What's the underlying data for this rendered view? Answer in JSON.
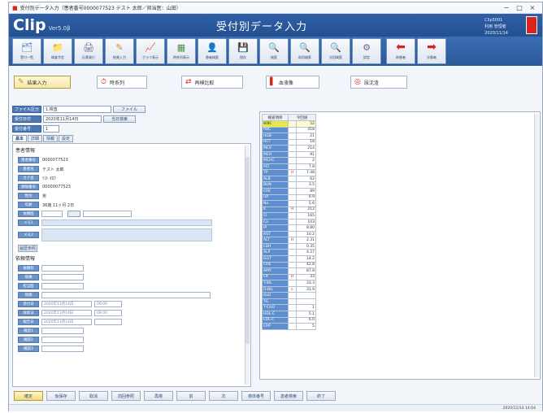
{
  "window": {
    "title": "受付別データ入力（患者番号0000077523 テスト 太郎／担当医：山田）",
    "controls": [
      "−",
      "□",
      "×"
    ]
  },
  "header": {
    "logo": "Clip",
    "version": "Ver5.0β",
    "screen_title": "受付別データ入力",
    "info_line1": "Clip5001",
    "info_line2": "利用 管理者",
    "info_line3": "2020/11/14"
  },
  "toolbar": {
    "items": [
      {
        "label": "受付一覧",
        "icon": "🗂",
        "color": "#3d7fc6"
      },
      {
        "label": "検査予定",
        "icon": "📁",
        "color": "#c9a13a"
      },
      {
        "label": "伝票発行",
        "icon": "🖨",
        "color": "#5c6e86"
      },
      {
        "label": "結果入力",
        "icon": "✎",
        "color": "#d88a26"
      },
      {
        "label": "グラフ表示",
        "icon": "📈",
        "color": "#cf3f3f"
      },
      {
        "label": "時系列表示",
        "icon": "▦",
        "color": "#4f8f4f"
      },
      {
        "label": "患者検索",
        "icon": "👤",
        "color": "#3f6fae"
      },
      {
        "label": "保存",
        "icon": "💾",
        "color": "#2f4f7f"
      },
      {
        "label": "検索",
        "icon": "🔍",
        "color": "#3f6fae"
      },
      {
        "label": "前回検索",
        "icon": "🔍",
        "color": "#3f6fae"
      },
      {
        "label": "次回検索",
        "icon": "🔍",
        "color": "#3f6fae"
      },
      {
        "label": "設定",
        "icon": "⚙",
        "color": "#5a6f8a"
      },
      {
        "label": "前患者",
        "icon": "⬅",
        "color": "#d8241f"
      },
      {
        "label": "次患者",
        "icon": "➡",
        "color": "#d8241f"
      }
    ]
  },
  "modes": {
    "items": [
      {
        "label": "結果入力",
        "icon": "✎",
        "active": true
      },
      {
        "label": "時系列",
        "icon": "⏱",
        "active": false
      },
      {
        "label": "再検比較",
        "icon": "⇄",
        "active": false
      },
      {
        "label": "血液像",
        "icon": "▌",
        "active": false
      },
      {
        "label": "尿沈渣",
        "icon": "◎",
        "active": false
      }
    ]
  },
  "form": {
    "type_label": "ファイル区分",
    "type_value": "1.検査",
    "sel_button": "ファイル",
    "date_label": "受付日付",
    "date_value": "2020年11月14日",
    "date_button": "当日検索",
    "number_label": "受付番号",
    "number_value": "1"
  },
  "tabs": [
    "基本",
    "詳細",
    "情報",
    "設定"
  ],
  "patient": {
    "section_title": "患者情報",
    "rows": [
      {
        "label": "患者番号",
        "value": "0000077523"
      },
      {
        "label": "患者名",
        "value": "テスト 太郎"
      },
      {
        "label": "カナ名",
        "value": "ﾃｽﾄ ﾀﾛｳ"
      },
      {
        "label": "保険番号",
        "value": "00000077523"
      },
      {
        "label": "性別",
        "value": "男"
      },
      {
        "label": "年齢",
        "value": "36歳 11ヶ月 2日"
      }
    ],
    "button_row_label": "依頼医",
    "memo_label1": "メモ1",
    "memo_label2": "メモ2",
    "history_button": "履歴参照"
  },
  "request": {
    "section_title": "依頼情報",
    "rows": [
      {
        "label": "依頼科",
        "value": ""
      },
      {
        "label": "病棟",
        "value": ""
      },
      {
        "label": "担当医",
        "value": ""
      },
      {
        "label": "保険",
        "value": ""
      },
      {
        "label": "受付日",
        "value": "2020年11月14日",
        "time": "09:00"
      },
      {
        "label": "採取日",
        "value": "2020年11月14日",
        "time": "09:00"
      },
      {
        "label": "報告日",
        "value": "2020年11月14日",
        "time": ""
      },
      {
        "label": "確認1",
        "value": ""
      },
      {
        "label": "確認2",
        "value": ""
      },
      {
        "label": "確認3",
        "value": ""
      }
    ]
  },
  "results": {
    "col_item": "検査項目",
    "col_value": "今回値",
    "rows": [
      {
        "item": "WBC",
        "flag": "",
        "value": "52",
        "highlight": true
      },
      {
        "item": "RBC",
        "flag": "",
        "value": "418",
        "highlight": false
      },
      {
        "item": "HGB",
        "flag": "",
        "value": "21",
        "highlight": false
      },
      {
        "item": "HCT",
        "flag": "",
        "value": "18",
        "highlight": false
      },
      {
        "item": "MCV",
        "flag": "",
        "value": "214",
        "highlight": false
      },
      {
        "item": "MCH",
        "flag": "",
        "value": "91",
        "highlight": false
      },
      {
        "item": "MCHC",
        "flag": "",
        "value": "2",
        "highlight": false
      },
      {
        "item": "PLT",
        "flag": "",
        "value": "7.8",
        "highlight": false
      },
      {
        "item": "TP",
        "flag": "H",
        "value": "7.48",
        "highlight": false
      },
      {
        "item": "ALB",
        "flag": "",
        "value": "62",
        "highlight": false
      },
      {
        "item": "BUN",
        "flag": "",
        "value": "3.5",
        "highlight": false
      },
      {
        "item": "CRE",
        "flag": "",
        "value": "89",
        "highlight": false
      },
      {
        "item": "UA",
        "flag": "",
        "value": "6.9",
        "highlight": false
      },
      {
        "item": "Na",
        "flag": "",
        "value": "5.6",
        "highlight": false
      },
      {
        "item": "K",
        "flag": "H",
        "value": "212",
        "highlight": false
      },
      {
        "item": "Cl",
        "flag": "",
        "value": "165",
        "highlight": false
      },
      {
        "item": "Ca",
        "flag": "",
        "value": "103",
        "highlight": false
      },
      {
        "item": "IP",
        "flag": "",
        "value": "8.80",
        "highlight": false
      },
      {
        "item": "AST",
        "flag": "",
        "value": "10.2",
        "highlight": false
      },
      {
        "item": "ALT",
        "flag": "H",
        "value": "2.31",
        "highlight": false
      },
      {
        "item": "LDH",
        "flag": "",
        "value": "0.35",
        "highlight": false
      },
      {
        "item": "ALP",
        "flag": "",
        "value": "4.27",
        "highlight": false
      },
      {
        "item": "GGT",
        "flag": "",
        "value": "14.2",
        "highlight": false
      },
      {
        "item": "CHE",
        "flag": "",
        "value": "42.8",
        "highlight": false
      },
      {
        "item": "AMY",
        "flag": "",
        "value": "87.8",
        "highlight": false
      },
      {
        "item": "CK",
        "flag": "H",
        "value": "33",
        "highlight": false
      },
      {
        "item": "T-BIL",
        "flag": "",
        "value": "33.3",
        "highlight": false
      },
      {
        "item": "D-BIL",
        "flag": "L",
        "value": "31.9",
        "highlight": false
      },
      {
        "item": "GLU",
        "flag": "",
        "value": "",
        "highlight": false
      },
      {
        "item": "TG",
        "flag": "",
        "value": "",
        "highlight": false
      },
      {
        "item": "T-CHO",
        "flag": "",
        "value": "1",
        "highlight": false
      },
      {
        "item": "HDL-C",
        "flag": "",
        "value": "5.1",
        "highlight": false
      },
      {
        "item": "LDL-C",
        "flag": "",
        "value": "6.0",
        "highlight": false
      },
      {
        "item": "CRP",
        "flag": "",
        "value": "5",
        "highlight": false
      }
    ]
  },
  "bottom": {
    "buttons": [
      "確定",
      "仮保存",
      "取消",
      "前回参照",
      "再検",
      "前",
      "次",
      "検体番号",
      "患者検索",
      "終了"
    ]
  },
  "status": {
    "text": "2020/11/14 14:04"
  }
}
